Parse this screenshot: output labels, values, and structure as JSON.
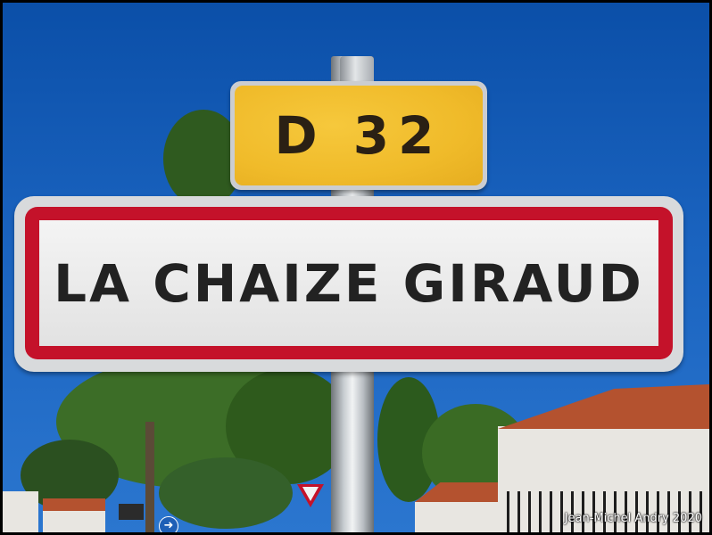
{
  "route_sign": {
    "text": "D 32",
    "color": "#f0bb2a"
  },
  "town_sign": {
    "name": "LA CHAIZE GIRAUD",
    "border_color": "#c4122a"
  },
  "watermark": {
    "text": "Jean-Michel Andry 2020"
  }
}
